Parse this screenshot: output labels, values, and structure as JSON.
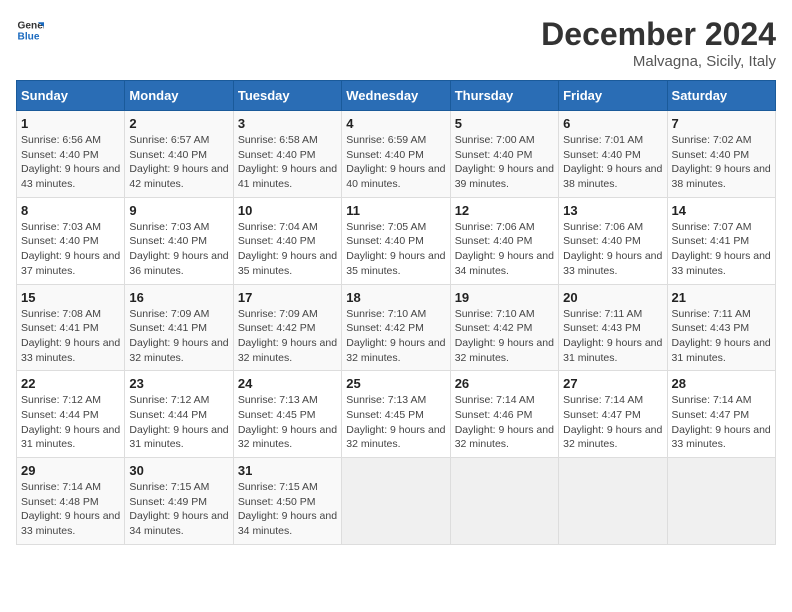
{
  "header": {
    "logo_line1": "General",
    "logo_line2": "Blue",
    "month": "December 2024",
    "location": "Malvagna, Sicily, Italy"
  },
  "weekdays": [
    "Sunday",
    "Monday",
    "Tuesday",
    "Wednesday",
    "Thursday",
    "Friday",
    "Saturday"
  ],
  "weeks": [
    [
      {
        "day": "1",
        "sunrise": "6:56 AM",
        "sunset": "4:40 PM",
        "daylight": "9 hours and 43 minutes."
      },
      {
        "day": "2",
        "sunrise": "6:57 AM",
        "sunset": "4:40 PM",
        "daylight": "9 hours and 42 minutes."
      },
      {
        "day": "3",
        "sunrise": "6:58 AM",
        "sunset": "4:40 PM",
        "daylight": "9 hours and 41 minutes."
      },
      {
        "day": "4",
        "sunrise": "6:59 AM",
        "sunset": "4:40 PM",
        "daylight": "9 hours and 40 minutes."
      },
      {
        "day": "5",
        "sunrise": "7:00 AM",
        "sunset": "4:40 PM",
        "daylight": "9 hours and 39 minutes."
      },
      {
        "day": "6",
        "sunrise": "7:01 AM",
        "sunset": "4:40 PM",
        "daylight": "9 hours and 38 minutes."
      },
      {
        "day": "7",
        "sunrise": "7:02 AM",
        "sunset": "4:40 PM",
        "daylight": "9 hours and 38 minutes."
      }
    ],
    [
      {
        "day": "8",
        "sunrise": "7:03 AM",
        "sunset": "4:40 PM",
        "daylight": "9 hours and 37 minutes."
      },
      {
        "day": "9",
        "sunrise": "7:03 AM",
        "sunset": "4:40 PM",
        "daylight": "9 hours and 36 minutes."
      },
      {
        "day": "10",
        "sunrise": "7:04 AM",
        "sunset": "4:40 PM",
        "daylight": "9 hours and 35 minutes."
      },
      {
        "day": "11",
        "sunrise": "7:05 AM",
        "sunset": "4:40 PM",
        "daylight": "9 hours and 35 minutes."
      },
      {
        "day": "12",
        "sunrise": "7:06 AM",
        "sunset": "4:40 PM",
        "daylight": "9 hours and 34 minutes."
      },
      {
        "day": "13",
        "sunrise": "7:06 AM",
        "sunset": "4:40 PM",
        "daylight": "9 hours and 33 minutes."
      },
      {
        "day": "14",
        "sunrise": "7:07 AM",
        "sunset": "4:41 PM",
        "daylight": "9 hours and 33 minutes."
      }
    ],
    [
      {
        "day": "15",
        "sunrise": "7:08 AM",
        "sunset": "4:41 PM",
        "daylight": "9 hours and 33 minutes."
      },
      {
        "day": "16",
        "sunrise": "7:09 AM",
        "sunset": "4:41 PM",
        "daylight": "9 hours and 32 minutes."
      },
      {
        "day": "17",
        "sunrise": "7:09 AM",
        "sunset": "4:42 PM",
        "daylight": "9 hours and 32 minutes."
      },
      {
        "day": "18",
        "sunrise": "7:10 AM",
        "sunset": "4:42 PM",
        "daylight": "9 hours and 32 minutes."
      },
      {
        "day": "19",
        "sunrise": "7:10 AM",
        "sunset": "4:42 PM",
        "daylight": "9 hours and 32 minutes."
      },
      {
        "day": "20",
        "sunrise": "7:11 AM",
        "sunset": "4:43 PM",
        "daylight": "9 hours and 31 minutes."
      },
      {
        "day": "21",
        "sunrise": "7:11 AM",
        "sunset": "4:43 PM",
        "daylight": "9 hours and 31 minutes."
      }
    ],
    [
      {
        "day": "22",
        "sunrise": "7:12 AM",
        "sunset": "4:44 PM",
        "daylight": "9 hours and 31 minutes."
      },
      {
        "day": "23",
        "sunrise": "7:12 AM",
        "sunset": "4:44 PM",
        "daylight": "9 hours and 31 minutes."
      },
      {
        "day": "24",
        "sunrise": "7:13 AM",
        "sunset": "4:45 PM",
        "daylight": "9 hours and 32 minutes."
      },
      {
        "day": "25",
        "sunrise": "7:13 AM",
        "sunset": "4:45 PM",
        "daylight": "9 hours and 32 minutes."
      },
      {
        "day": "26",
        "sunrise": "7:14 AM",
        "sunset": "4:46 PM",
        "daylight": "9 hours and 32 minutes."
      },
      {
        "day": "27",
        "sunrise": "7:14 AM",
        "sunset": "4:47 PM",
        "daylight": "9 hours and 32 minutes."
      },
      {
        "day": "28",
        "sunrise": "7:14 AM",
        "sunset": "4:47 PM",
        "daylight": "9 hours and 33 minutes."
      }
    ],
    [
      {
        "day": "29",
        "sunrise": "7:14 AM",
        "sunset": "4:48 PM",
        "daylight": "9 hours and 33 minutes."
      },
      {
        "day": "30",
        "sunrise": "7:15 AM",
        "sunset": "4:49 PM",
        "daylight": "9 hours and 34 minutes."
      },
      {
        "day": "31",
        "sunrise": "7:15 AM",
        "sunset": "4:50 PM",
        "daylight": "9 hours and 34 minutes."
      },
      null,
      null,
      null,
      null
    ]
  ]
}
